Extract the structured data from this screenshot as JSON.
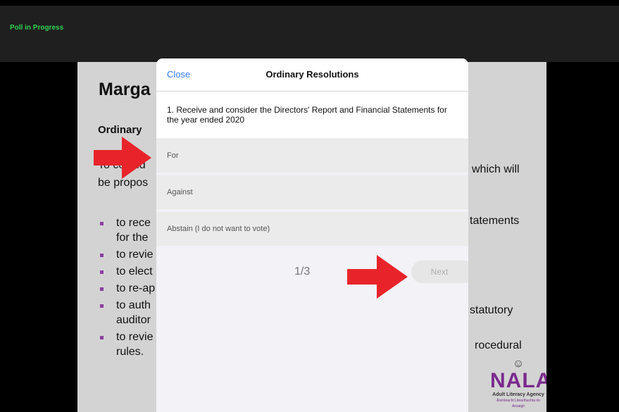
{
  "topbar": {
    "status": "Poll in Progress"
  },
  "slide": {
    "title": "Marga",
    "subtitle": "Ordinary",
    "intro_left": "To consid",
    "intro_right": "which will",
    "intro_left2": "be propos",
    "bullets": [
      {
        "left": "to rece",
        "right": "tatements"
      },
      {
        "left": "for the",
        "right": ""
      },
      {
        "left": "to revie",
        "right": ""
      },
      {
        "left": "to elect",
        "right": ""
      },
      {
        "left": "to re-ap",
        "right": ""
      },
      {
        "left": "to auth",
        "right": "statutory"
      },
      {
        "left": "auditor",
        "right": ""
      },
      {
        "left": "to revie",
        "right": "rocedural"
      },
      {
        "left": "rules.",
        "right": ""
      }
    ],
    "logo": {
      "word": "NALA",
      "agency": "Adult Literacy Agency",
      "agency_irish": "Áisínteacht Litearthachta do Aosaigh"
    }
  },
  "modal": {
    "close_label": "Close",
    "title": "Ordinary Resolutions",
    "question": "1. Receive and consider the Directors' Report and Financial Statements for the year ended 2020",
    "options": [
      "For",
      "Against",
      "Abstain (I do not want to vote)"
    ],
    "page_indicator": "1/3",
    "next_label": "Next"
  },
  "colors": {
    "status_green": "#2fd152",
    "link_blue": "#2f7bf6",
    "arrow_red": "#e8242a",
    "nala_purple": "#7a2a8e"
  },
  "icons": [
    "red-arrow-icon",
    "person-icon"
  ]
}
